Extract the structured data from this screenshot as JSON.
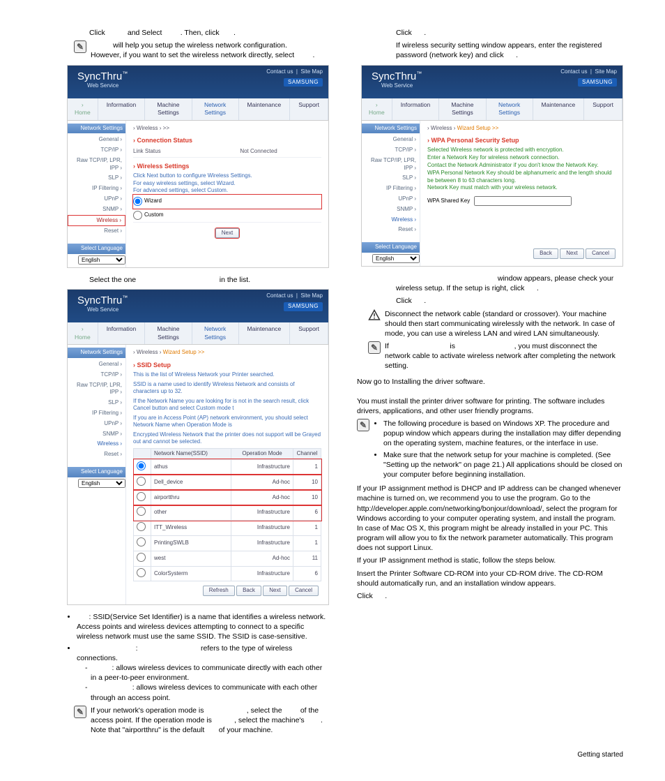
{
  "left": {
    "step8": {
      "prefix": "Click",
      "mid1": "and Select",
      "mid2": ". Then, click",
      "end": "."
    },
    "note1_l1": "will help you setup the wireless network configuration.",
    "note1_l2": "However, if you want to set the wireless network directly, select",
    "note1_end": ".",
    "panel1": {
      "brand": "SyncThru",
      "brand_sub": "Web Service",
      "top_link1": "Contact us",
      "top_link2": "Site Map",
      "badge": "SAMSUNG",
      "tabs": {
        "home": "Home",
        "t1": "Information",
        "t2": "Machine Settings",
        "t3": "Network Settings",
        "t4": "Maintenance",
        "t5": "Support"
      },
      "sidebar": {
        "header": "Network Settings",
        "items": [
          "General ›",
          "TCP/IP ›",
          "Raw TCP/IP, LPR, IPP ›",
          "SLP ›",
          "IP Filtering ›",
          "UPnP ›",
          "SNMP ›",
          "Wireless ›",
          "Reset ›"
        ],
        "lang_header": "Select Language",
        "lang": "English"
      },
      "crumbs_prefix": "› Wireless › >>",
      "conn_title": "› Connection Status",
      "link_status_k": "Link Status",
      "link_status_v": "Not Connected",
      "ws_title": "› Wireless Settings",
      "hint1": "Click Next button to configure Wireless Settings.",
      "hint2": "For easy wireless settings, select Wizard.",
      "hint3": "For advanced settings, select Custom.",
      "opt_wizard": "Wizard",
      "opt_custom": "Custom",
      "next": "Next"
    },
    "step9": {
      "a": "Select the one",
      "b": "in the list."
    },
    "panel2": {
      "crumbs": "› Wireless › Wizard Setup >>",
      "title": "› SSID Setup",
      "h1": "This is the list of Wireless Network your Printer searched.",
      "h2": "SSID is a name used to identify Wireless Network and consists of characters up to 32.",
      "h3": "If the Network Name you are looking for is not in the search result, click Cancel button and select Custom mode t",
      "h4": "If you are in Access Point (AP) network environment, you should select Network Name when Operation Mode is",
      "h5": "Encrypted Wireless Network that the printer does not support will be Grayed out and cannot be selected.",
      "cols": [
        "",
        "Network Name(SSID)",
        "Operation Mode",
        "Channel"
      ],
      "rows": [
        {
          "n": "athus",
          "m": "Infrastructure",
          "c": "1",
          "sel": true
        },
        {
          "n": "Dell_device",
          "m": "Ad-hoc",
          "c": "10"
        },
        {
          "n": "airportthru",
          "m": "Ad-hoc",
          "c": "10"
        },
        {
          "n": "other",
          "m": "Infrastructure",
          "c": "6"
        },
        {
          "n": "ITT_Wireless",
          "m": "Infrastructure",
          "c": "1"
        },
        {
          "n": "PrintingSWLB",
          "m": "Infrastructure",
          "c": "1"
        },
        {
          "n": "west",
          "m": "Ad-hoc",
          "c": "11"
        },
        {
          "n": "ColorSysterm",
          "m": "Infrastructure",
          "c": "6"
        }
      ],
      "btns": [
        "Refresh",
        "Back",
        "Next",
        "Cancel"
      ]
    },
    "ssid_b": ": SSID(Service Set Identifier) is a name that identifies a wireless network. Access points and wireless devices attempting to connect to a specific wireless network must use the same SSID. The SSID is case-sensitive.",
    "om_a": ":",
    "om_b": "refers to the type of wireless connections.",
    "adhoc": ": allows wireless devices to communicate directly with each other in a peer-to-peer environment.",
    "infra": ": allows wireless devices to communicate with each other through an access point.",
    "note2": {
      "l1a": "If your network's operation mode is",
      "l1b": ", select the",
      "l2a": "of the access point. If the operation mode is",
      "l2b": ", select the machine's",
      "l2c": ". Note that \"airportthru\" is the default",
      "l2d": "of your machine."
    }
  },
  "right": {
    "step10": {
      "a": "Click",
      "b": "."
    },
    "step10_l2": "If wireless security setting window appears, enter the registered password (network key) and click",
    "step10_end": ".",
    "panel3": {
      "crumbs": "› Wireless › Wizard Setup >>",
      "title": "› WPA Personal Security Setup",
      "g1": "Selected Wireless network is protected with encryption.",
      "g2": "Enter a Network Key for wireless network connection.",
      "g3": "Contact the Network Administrator if you don't know the Network Key.",
      "g4": "WPA Personal Network Key should be alphanumeric and the length should be between 8 to 63 characters long.",
      "g5": "Network Key must match with your wireless network.",
      "field_label": "WPA Shared Key",
      "btns": [
        "Back",
        "Next",
        "Cancel"
      ]
    },
    "step11_a": "window appears, please check your wireless setup. If the setup is right, click",
    "step11_end": ".",
    "step12": {
      "a": "Click",
      "b": "."
    },
    "warn": "Disconnect the network cable (standard or crossover). Your machine should then start communicating wirelessly with the network. In case of              mode, you can use a wireless LAN and wired LAN simultaneously.",
    "note3a": "If",
    "note3b": "is",
    "note3c": ", you must disconnect the network cable to activate wireless network after completing the network setting.",
    "goto": "Now go to Installing the driver software.",
    "driver_h": "",
    "driver_p": "You must install the printer driver software for printing. The software includes drivers, applications, and other user friendly programs.",
    "driver_b1": "The following procedure is based on Windows XP. The procedure and popup window which appears during the installation may differ depending on the operating system, machine features, or the interface in use.",
    "driver_b2": "Make sure that the network setup for your machine is completed. (See \"Setting up the network\" on page 21.) All applications should be closed on your computer before beginning installation.",
    "dhcp": "If your IP assignment method is DHCP and IP address can be changed whenever machine is turned on, we recommend you to use the program. Go to the http://developer.apple.com/networking/bonjour/download/, select the program              for Windows according to your computer operating system, and install the program. In case of Mac OS X, this program might be already installed in your PC. This program will allow you to fix the network parameter automatically. This              program does not support Linux.",
    "static": "If your IP assignment method is static, follow the steps below.",
    "s1": "Insert the Printer Software CD-ROM into your CD-ROM drive. The CD-ROM should automatically run, and an installation window appears.",
    "s2a": "Click",
    "s2b": "."
  },
  "footer": "Getting started"
}
